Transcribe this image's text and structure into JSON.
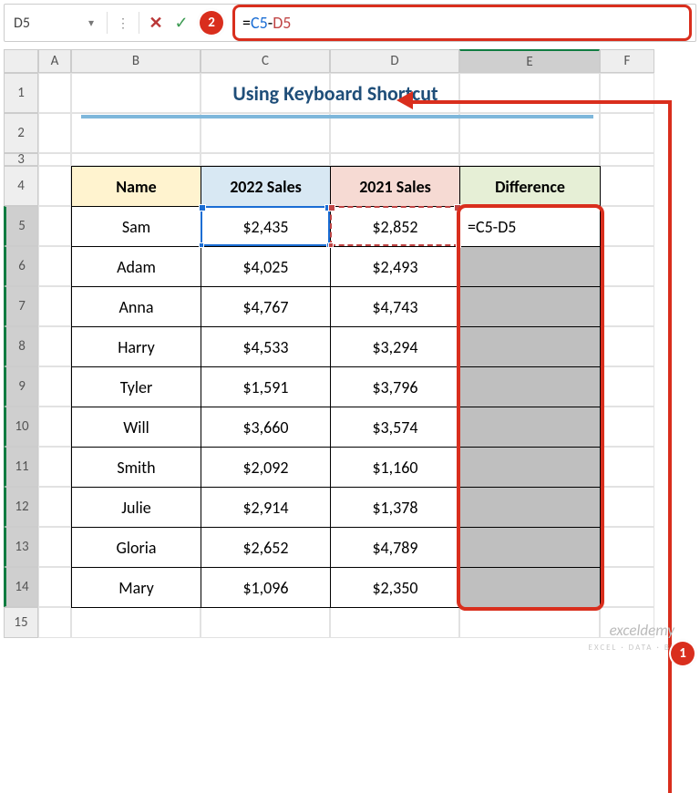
{
  "formula_bar": {
    "name_box": "D5",
    "formula_eq": "=",
    "formula_ref1": "C5",
    "formula_op": "-",
    "formula_ref2": "D5"
  },
  "annotations": {
    "badge1": "1",
    "badge2": "2"
  },
  "columns": {
    "A": "A",
    "B": "B",
    "C": "C",
    "D": "D",
    "E": "E",
    "F": "F"
  },
  "row_numbers": [
    "1",
    "2",
    "3",
    "4",
    "5",
    "6",
    "7",
    "8",
    "9",
    "10",
    "11",
    "12",
    "13",
    "14",
    "15"
  ],
  "title": "Using Keyboard Shortcut",
  "headers": {
    "name": "Name",
    "s2022": "2022 Sales",
    "s2021": "2021 Sales",
    "diff": "Difference"
  },
  "first_diff_formula": "=C5-D5",
  "rows": [
    {
      "name": "Sam",
      "s2022": "$2,435",
      "s2021": "$2,852"
    },
    {
      "name": "Adam",
      "s2022": "$4,025",
      "s2021": "$2,493"
    },
    {
      "name": "Anna",
      "s2022": "$4,767",
      "s2021": "$4,743"
    },
    {
      "name": "Harry",
      "s2022": "$4,533",
      "s2021": "$3,294"
    },
    {
      "name": "Tyler",
      "s2022": "$1,591",
      "s2021": "$3,796"
    },
    {
      "name": "Will",
      "s2022": "$3,660",
      "s2021": "$3,574"
    },
    {
      "name": "Smith",
      "s2022": "$2,092",
      "s2021": "$1,160"
    },
    {
      "name": "Julie",
      "s2022": "$2,914",
      "s2021": "$1,378"
    },
    {
      "name": "Gloria",
      "s2022": "$2,652",
      "s2021": "$4,789"
    },
    {
      "name": "Mary",
      "s2022": "$1,096",
      "s2021": "$2,350"
    }
  ],
  "watermark": "exceldemy",
  "watermark_sub": "EXCEL · DATA · BI",
  "chart_data": {
    "type": "table",
    "title": "Using Keyboard Shortcut",
    "columns": [
      "Name",
      "2022 Sales",
      "2021 Sales",
      "Difference"
    ],
    "rows": [
      [
        "Sam",
        2435,
        2852,
        null
      ],
      [
        "Adam",
        4025,
        2493,
        null
      ],
      [
        "Anna",
        4767,
        4743,
        null
      ],
      [
        "Harry",
        4533,
        3294,
        null
      ],
      [
        "Tyler",
        1591,
        3796,
        null
      ],
      [
        "Will",
        3660,
        3574,
        null
      ],
      [
        "Smith",
        2092,
        1160,
        null
      ],
      [
        "Julie",
        2914,
        1378,
        null
      ],
      [
        "Gloria",
        2652,
        4789,
        null
      ],
      [
        "Mary",
        1096,
        2350,
        null
      ]
    ],
    "difference_formula": "=C5-D5"
  }
}
